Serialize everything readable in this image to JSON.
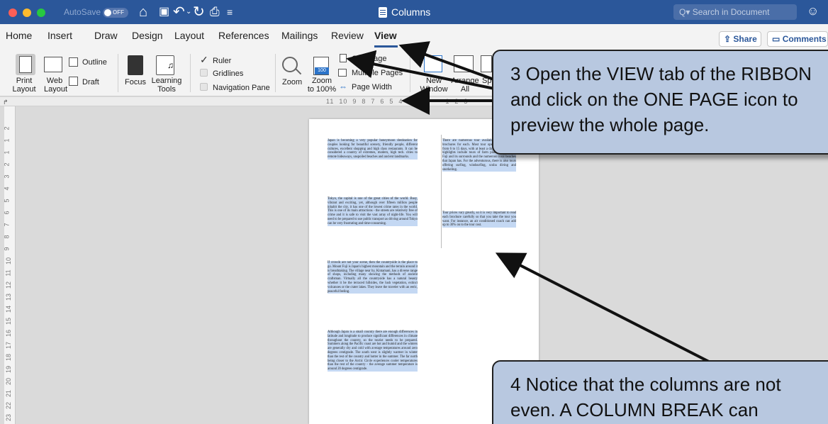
{
  "titlebar": {
    "autosave_label": "AutoSave",
    "autosave_state": "OFF",
    "document_title": "Columns",
    "search_placeholder": "Search in Document"
  },
  "tabs": [
    "Home",
    "Insert",
    "Draw",
    "Design",
    "Layout",
    "References",
    "Mailings",
    "Review",
    "View"
  ],
  "active_tab": "View",
  "share_label": "Share",
  "comments_label": "Comments",
  "ribbon": {
    "print_layout": "Print\nLayout",
    "web_layout": "Web\nLayout",
    "outline": "Outline",
    "draft": "Draft",
    "focus": "Focus",
    "learning_tools": "Learning\nTools",
    "ruler": "Ruler",
    "gridlines": "Gridlines",
    "navigation_pane": "Navigation Pane",
    "zoom": "Zoom",
    "zoom_100": "Zoom\nto 100%",
    "zoom_icon_text": "100",
    "one_page": "One Page",
    "multiple_pages": "Multiple Pages",
    "page_width": "Page Width",
    "new_window": "New\nWindow",
    "arrange": "Arrange\nAll",
    "split": "Sp"
  },
  "ruler_checked": true,
  "gridlines_checked": false,
  "navigation_pane_checked": false,
  "ruler_numbers": "11  10  9  8  7  6  5  4  3  2  1      1  2  3",
  "vertical_ruler_numbers": [
    "2",
    "1",
    "1",
    "2",
    "3",
    "4",
    "5",
    "6",
    "7",
    "8",
    "9",
    "10",
    "11",
    "12",
    "13",
    "14",
    "15",
    "16",
    "17",
    "18",
    "19",
    "20",
    "21",
    "22",
    "23",
    "24"
  ],
  "document": {
    "col1": [
      "Japan is becoming a very popular honeymoon destination for couples looking for beautiful scenery, friendly people, different cultures, excellent shopping and high class restaurants. It can be considered a country of extremes, modern, high tech. cities to remote hideaways, unspoiled beaches and ancient landmarks.",
      "Tokyo, the capital is one of the great cities of the world. Busy, vibrant and exciting, yet, although over fifteen million people inhabit the city, it has one of the lowest crime rates in the world. This is one of its main attractions - the streets are relatively free of crime and it is safe to visit the vast array of night-life. You will need to be prepared to use public transport as driving around Tokyo can be very frustrating and time-consuming.",
      "If crowds are not your scene, then the countryside is the place to go. Mount Fuji is Japan's highest mountain and the terrain around it is breathtaking. The village near by, Kintamani, has a diverse range of shops, including many showing the methods of ancient craftsman. Virtually all the countryside has a natural beauty whether it be the terraced hillsides, the lush vegetation, extinct volcanoes or the crater lakes. They leave the traveler with an eeric, peaceful feeling.",
      "Although Japan is a small country there are enough differences in latitude and longitude to produce significant differences in climate throughout the country, so the tourist needs to be prepared. Summers along the Pacific coast are hot and humid and the winters are generally dry and cold with average temperatures around zero degrees centigrade. The south west is slightly warmer in winter than the rest of the country and hotter in the summer. The far north being closer to the Arctic Circle experiences cooler temperatures than the rest of the country - the average summer temperature is around 20 degrees centigrade."
    ],
    "col2": [
      "There are numerous tour available and we have brochures for each. Most tour operators offer trips from 6 to 15 days, with at least a day in Tokyo. Other highlights include tours of farm plantations, Mount Fuji and its surrounds and the numerous coral beaches that Japan has. For the adventurous, there is also tours offering surfing, windsurfing, scuba diving and snorkeling.",
      "Tour prices vary greatly, so it is very important to read each brochure carefully so that you take the tour you want. For instance, an air conditioned coach can add up to 30% on to the tour cost."
    ]
  },
  "callouts": {
    "step3": "3  Open the VIEW tab of the RIBBON\n    and click on the ONE PAGE icon to\n    preview the whole page.",
    "step4": "4  Notice that the columns are not\n    even.  A COLUMN BREAK can"
  },
  "colors": {
    "titlebar": "#2b579a",
    "callout_fill": "#b8c8e0",
    "selection": "#c4d8f3",
    "close": "#fd5f57",
    "minimize": "#febb2e",
    "zoom": "#27c840"
  }
}
